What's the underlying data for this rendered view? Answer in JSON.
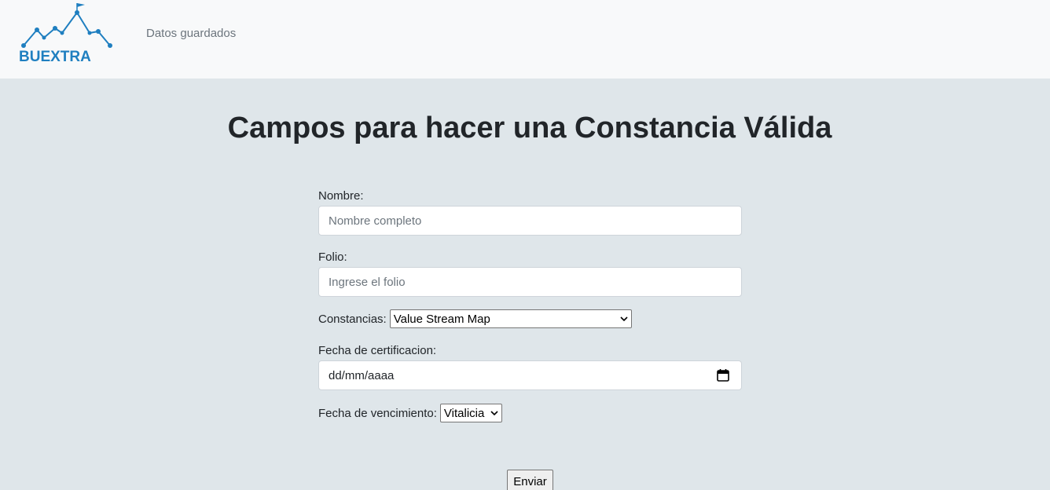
{
  "brand": {
    "logo_text": "BUEXTRA",
    "logo_color": "#1f7fc0"
  },
  "nav": {
    "link_label": "Datos guardados"
  },
  "page": {
    "title": "Campos para hacer una Constancia Válida"
  },
  "form": {
    "nombre": {
      "label": "Nombre:",
      "placeholder": "Nombre completo"
    },
    "folio": {
      "label": "Folio:",
      "placeholder": "Ingrese el folio"
    },
    "constancias": {
      "label": "Constancias:",
      "selected": "Value Stream Map"
    },
    "fecha_certificacion": {
      "label": "Fecha de certificacion:",
      "value": "dd/mm/aaaa"
    },
    "fecha_vencimiento": {
      "label": "Fecha de vencimiento:",
      "selected": "Vitalicia"
    },
    "submit_label": "Enviar"
  },
  "colors": {
    "navbar_bg": "#f8f9fa",
    "page_bg": "#dfe6ea",
    "accent": "#1f7fc0"
  }
}
